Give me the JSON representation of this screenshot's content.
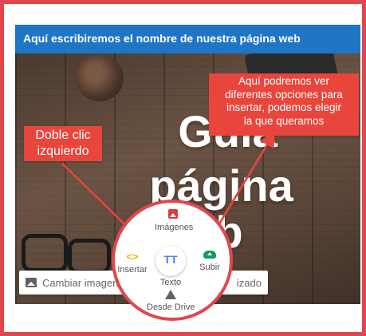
{
  "site_header": {
    "title": "Aquí escribiremos el nombre de nuestra página web"
  },
  "hero": {
    "line1": "Guía",
    "line2": "página",
    "line3": "b"
  },
  "controls": {
    "change_image_label": "Cambiar imagen",
    "partial_button_label": "izado"
  },
  "insert_menu": {
    "images_label": "Imágenes",
    "insert_label": "Insertar",
    "insert_glyph": "<>",
    "text_label": "Texto",
    "text_glyph": "TT",
    "upload_label": "Subir",
    "drive_label": "Desde Drive"
  },
  "callouts": {
    "left_line1": "Doble clic",
    "left_line2": "izquierdo",
    "right_line1": "Aquí podremos ver",
    "right_line2": "diferentes opciones para",
    "right_line3": "insertar, podemos elegir",
    "right_line4": "la que queramos"
  },
  "colors": {
    "frame": "#e0474c",
    "header": "#1f76c4",
    "callout": "#e8453c"
  }
}
